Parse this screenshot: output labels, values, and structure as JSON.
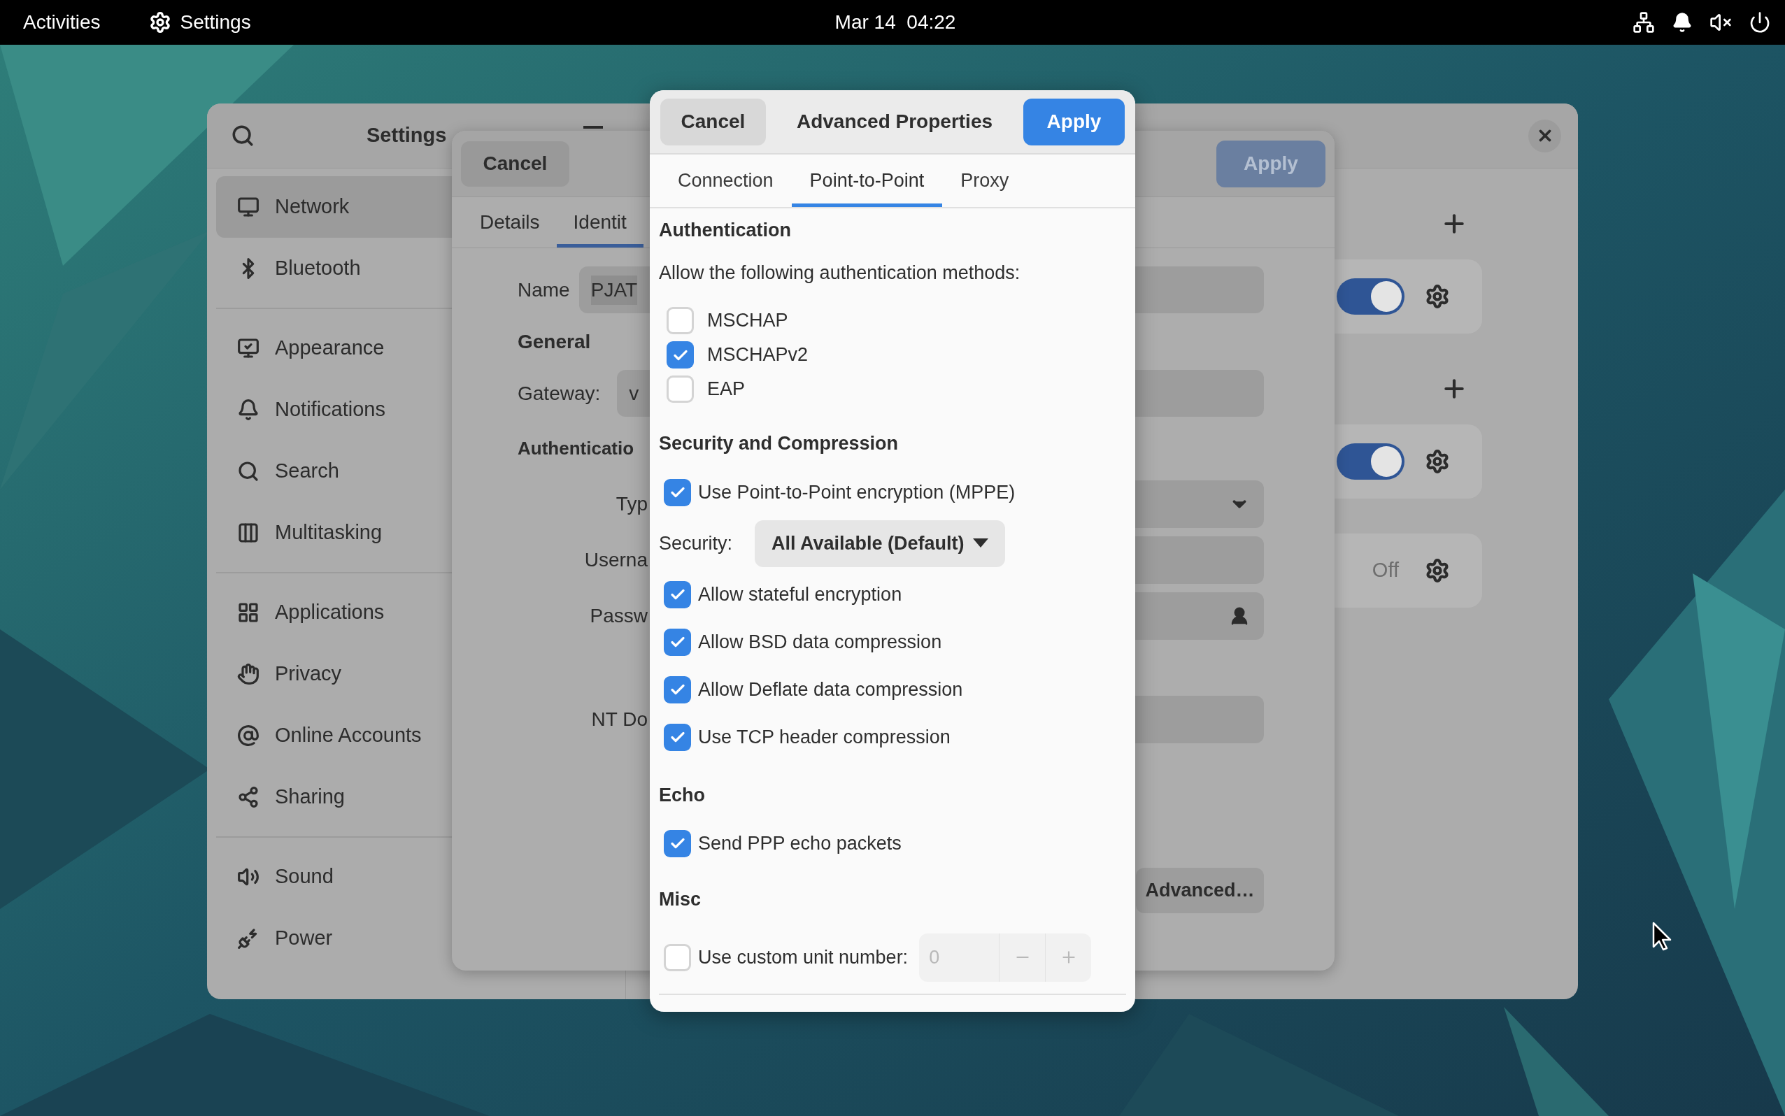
{
  "top_bar": {
    "activities": "Activities",
    "app_menu": "Settings",
    "clock": "Mar 14  04:22"
  },
  "settings_window": {
    "title": "Settings",
    "sidebar": {
      "sections": [
        [
          {
            "label": "Network",
            "selected": true
          },
          {
            "label": "Bluetooth",
            "selected": false
          }
        ],
        [
          {
            "label": "Appearance",
            "selected": false
          },
          {
            "label": "Notifications",
            "selected": false
          },
          {
            "label": "Search",
            "selected": false
          },
          {
            "label": "Multitasking",
            "selected": false
          }
        ],
        [
          {
            "label": "Applications",
            "selected": false
          },
          {
            "label": "Privacy",
            "selected": false
          },
          {
            "label": "Online Accounts",
            "selected": false
          },
          {
            "label": "Sharing",
            "selected": false
          }
        ],
        [
          {
            "label": "Sound",
            "selected": false
          },
          {
            "label": "Power",
            "selected": false
          }
        ]
      ]
    },
    "connection_groups": [
      {
        "rows": [
          {
            "kind": "switch",
            "on": true
          }
        ]
      },
      {
        "rows": [
          {
            "kind": "switch",
            "on": true
          },
          {
            "kind": "status",
            "status": "Off"
          }
        ]
      }
    ]
  },
  "vpn_dialog": {
    "cancel": "Cancel",
    "apply": "Apply",
    "tabs": [
      {
        "label": "Details",
        "selected": false
      },
      {
        "label": "Identit",
        "selected": true
      }
    ],
    "name_label": "Name",
    "name_value": "PJAT",
    "general_heading": "General",
    "gateway_label": "Gateway:",
    "gateway_value": "v",
    "auth_heading": "Authenticatio",
    "auth_rows": [
      {
        "kind": "dropdown",
        "label": "Typ"
      },
      {
        "kind": "field",
        "label": "Userna"
      },
      {
        "kind": "password",
        "label": "Passw"
      },
      {
        "kind": "field",
        "label": "NT Do"
      }
    ],
    "advanced": "Advanced…"
  },
  "advanced_dialog": {
    "title": "Advanced Properties",
    "cancel": "Cancel",
    "apply": "Apply",
    "tabs": [
      {
        "label": "Connection",
        "selected": false
      },
      {
        "label": "Point-to-Point",
        "selected": true
      },
      {
        "label": "Proxy",
        "selected": false
      }
    ],
    "sections": [
      {
        "heading": "Authentication",
        "description": "Allow the following authentication methods:",
        "items": [
          {
            "kind": "method",
            "label": "MSCHAP",
            "checked": false
          },
          {
            "kind": "method",
            "label": "MSCHAPv2",
            "checked": true
          },
          {
            "kind": "method",
            "label": "EAP",
            "checked": false
          }
        ]
      },
      {
        "heading": "Security and Compression",
        "items": [
          {
            "kind": "checkbox",
            "label": "Use Point-to-Point encryption (MPPE)",
            "checked": true
          },
          {
            "kind": "dropdown",
            "label": "Security:",
            "value": "All Available (Default)"
          },
          {
            "kind": "checkbox",
            "label": "Allow stateful encryption",
            "checked": true
          },
          {
            "kind": "checkbox",
            "label": "Allow BSD data compression",
            "checked": true
          },
          {
            "kind": "checkbox",
            "label": "Allow Deflate data compression",
            "checked": true
          },
          {
            "kind": "checkbox",
            "label": "Use TCP header compression",
            "checked": true
          }
        ]
      },
      {
        "heading": "Echo",
        "items": [
          {
            "kind": "checkbox",
            "label": "Send PPP echo packets",
            "checked": true
          }
        ]
      },
      {
        "heading": "Misc",
        "items": [
          {
            "kind": "spin",
            "label": "Use custom unit number:",
            "checked": false,
            "value": "0",
            "disabled": true
          }
        ]
      }
    ]
  }
}
